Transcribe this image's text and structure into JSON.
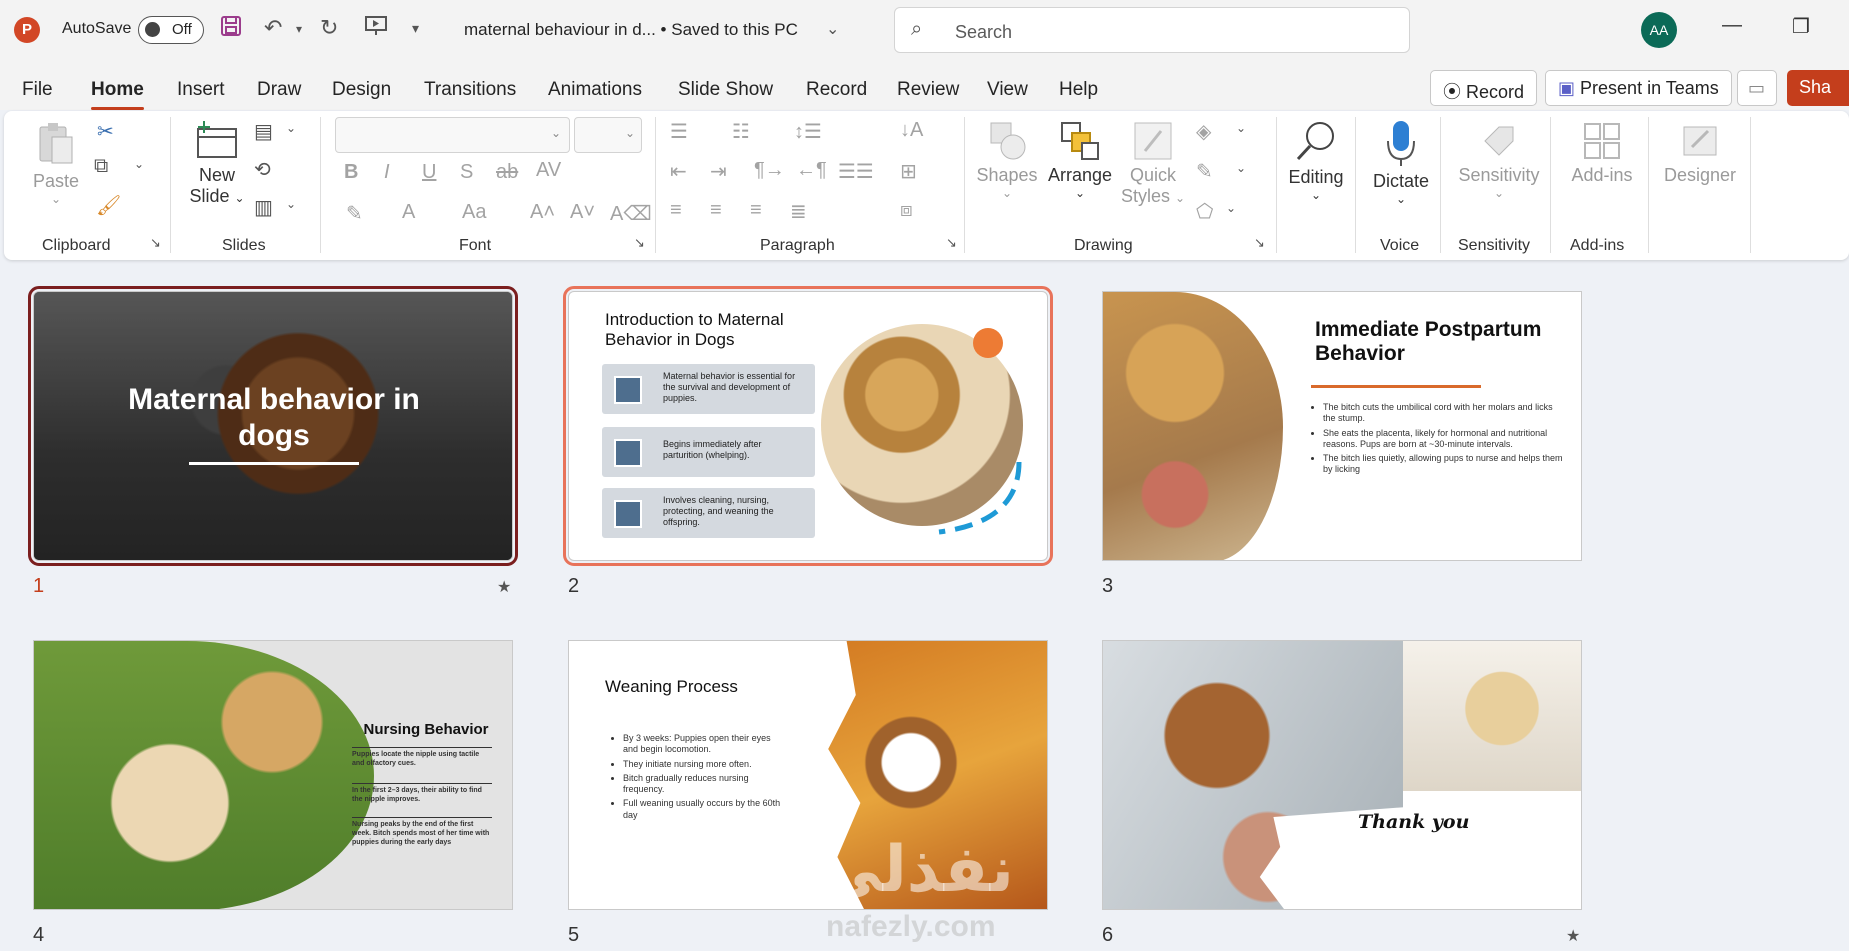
{
  "titlebar": {
    "app_logo": "P",
    "autosave_label": "AutoSave",
    "autosave_state": "Off",
    "doc_title": "maternal behaviour in d...  •  Saved to this PC",
    "search_placeholder": "Search",
    "avatar_initials": "AA"
  },
  "menu": {
    "tabs": [
      "File",
      "Home",
      "Insert",
      "Draw",
      "Design",
      "Transitions",
      "Animations",
      "Slide Show",
      "Record",
      "Review",
      "View",
      "Help"
    ],
    "active_tab": "Home",
    "record_label": "Record",
    "present_label": "Present in Teams",
    "share_label": "Sha"
  },
  "ribbon": {
    "groups": {
      "clipboard": "Clipboard",
      "slides": "Slides",
      "font": "Font",
      "paragraph": "Paragraph",
      "drawing": "Drawing",
      "voice": "Voice",
      "sensitivity": "Sensitivity",
      "addins": "Add-ins"
    },
    "buttons": {
      "paste": "Paste",
      "new_slide_1": "New",
      "new_slide_2": "Slide",
      "shapes": "Shapes",
      "arrange": "Arrange",
      "quick_styles_1": "Quick",
      "quick_styles_2": "Styles",
      "editing": "Editing",
      "dictate": "Dictate",
      "sensitivity": "Sensitivity",
      "addins": "Add-ins",
      "designer": "Designer"
    }
  },
  "slides": [
    {
      "number": "1",
      "title": "Maternal behavior in dogs"
    },
    {
      "number": "2",
      "title": "Introduction to Maternal Behavior in Dogs",
      "cards": [
        "Maternal behavior is essential for the survival and development of puppies.",
        "Begins immediately after parturition (whelping).",
        "Involves cleaning, nursing, protecting, and weaning the offspring."
      ]
    },
    {
      "number": "3",
      "title": "Immediate Postpartum Behavior",
      "bullets": [
        "The bitch cuts the umbilical cord with her molars and licks the stump.",
        "She eats the placenta, likely for hormonal and nutritional reasons. Pups are born at ~30-minute intervals.",
        "The bitch lies quietly, allowing pups to nurse and helps them by licking"
      ]
    },
    {
      "number": "4",
      "title": "Nursing Behavior",
      "paragraphs": [
        "Puppies locate the nipple using tactile and olfactory cues.",
        "In the first 2–3 days, their ability to find the nipple improves.",
        "Nursing peaks by the end of the first week. Bitch spends most of her time with puppies during the early days"
      ]
    },
    {
      "number": "5",
      "title": "Weaning Process",
      "bullets": [
        "By 3 weeks: Puppies open their eyes and begin locomotion.",
        "They initiate nursing more often.",
        "Bitch gradually reduces nursing frequency.",
        "Full weaning usually occurs by the 60th day"
      ]
    },
    {
      "number": "6",
      "title": "Thank you"
    }
  ],
  "watermark": {
    "text": "نفذلي",
    "url": "nafezly.com"
  },
  "colors": {
    "accent": "#c43e1c",
    "selected_outline": "#7b1f1f",
    "hover_outline": "#e8735a",
    "avatar": "#0b6a57"
  }
}
